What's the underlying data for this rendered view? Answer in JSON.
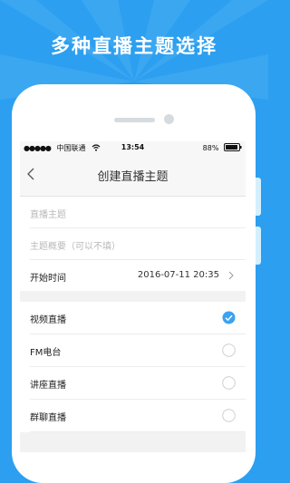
{
  "promo": {
    "title": "多种直播主题选择"
  },
  "status_bar": {
    "carrier": "中国联通",
    "time": "13:54",
    "battery": "88%"
  },
  "nav": {
    "title": "创建直播主题"
  },
  "form": {
    "topic_placeholder": "直播主题",
    "summary_placeholder": "主题概要（可以不填）",
    "start_time_label": "开始时间",
    "start_time_value": "2016-07-11  20:35"
  },
  "options": [
    {
      "label": "视频直播",
      "selected": true
    },
    {
      "label": "FM电台",
      "selected": false
    },
    {
      "label": "讲座直播",
      "selected": false
    },
    {
      "label": "群聊直播",
      "selected": false
    }
  ],
  "colors": {
    "background": "#2c9ff0",
    "accent": "#3aa3f2"
  }
}
